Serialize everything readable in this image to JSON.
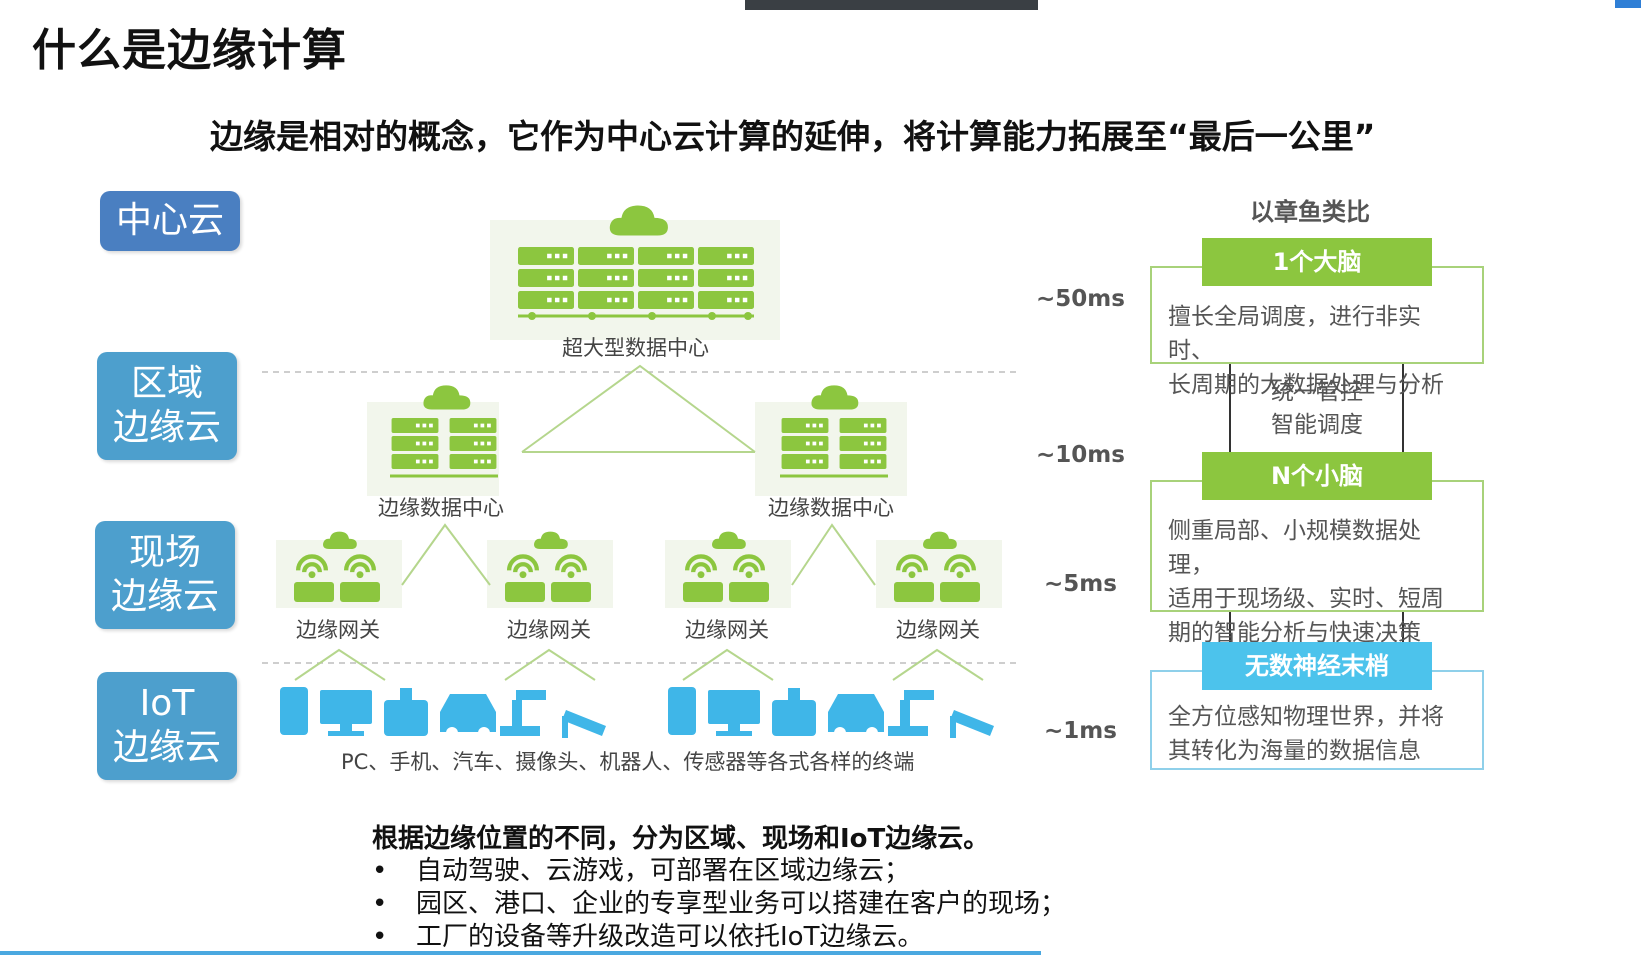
{
  "title": "什么是边缘计算",
  "subtitle": "边缘是相对的概念，它作为中心云计算的延伸，将计算能力拓展至“最后一公里”",
  "levels": [
    {
      "label": "中心云",
      "color": "#4a7fc1"
    },
    {
      "label": "区域\n边缘云",
      "color": "#4d9fcd"
    },
    {
      "label": "现场\n边缘云",
      "color": "#4d9fcd"
    },
    {
      "label": "IoT\n边缘云",
      "color": "#4d9fcd"
    }
  ],
  "diagram": {
    "super_dc_label": "超大型数据中心",
    "edge_dc_label": "边缘数据中心",
    "gateway_label": "边缘网关",
    "terminals_label": "PC、手机、汽车、摄像头、机器人、传感器等各式各样的终端",
    "server_color": "#8cc63f",
    "device_color": "#3fb6e8"
  },
  "latencies": [
    "~50ms",
    "~10ms",
    "~5ms",
    "~1ms"
  ],
  "octopus": {
    "title": "以章鱼类比",
    "big_brain": {
      "header": "1个大脑",
      "lines": [
        "擅长全局调度，进行非实时、",
        "长周期的大数据处理与分析"
      ]
    },
    "middle": [
      "统一管控",
      "智能调度"
    ],
    "small_brains": {
      "header": "N个小脑",
      "lines": [
        "侧重局部、小规模数据处理，",
        "适用于现场级、实时、短周",
        "期的智能分析与快速决策"
      ]
    },
    "nerves": {
      "header": "无数神经末梢",
      "lines": [
        "全方位感知物理世界，并将",
        "其转化为海量的数据信息"
      ]
    },
    "green": "#8cc63f",
    "blue": "#4cc3ec"
  },
  "notes": {
    "heading": "根据边缘位置的不同，分为区域、现场和IoT边缘云。",
    "bullets": [
      "自动驾驶、云游戏，可部署在区域边缘云；",
      "园区、港口、企业的专享型业务可以搭建在客户的现场；",
      "工厂的设备等升级改造可以依托IoT边缘云。"
    ]
  }
}
